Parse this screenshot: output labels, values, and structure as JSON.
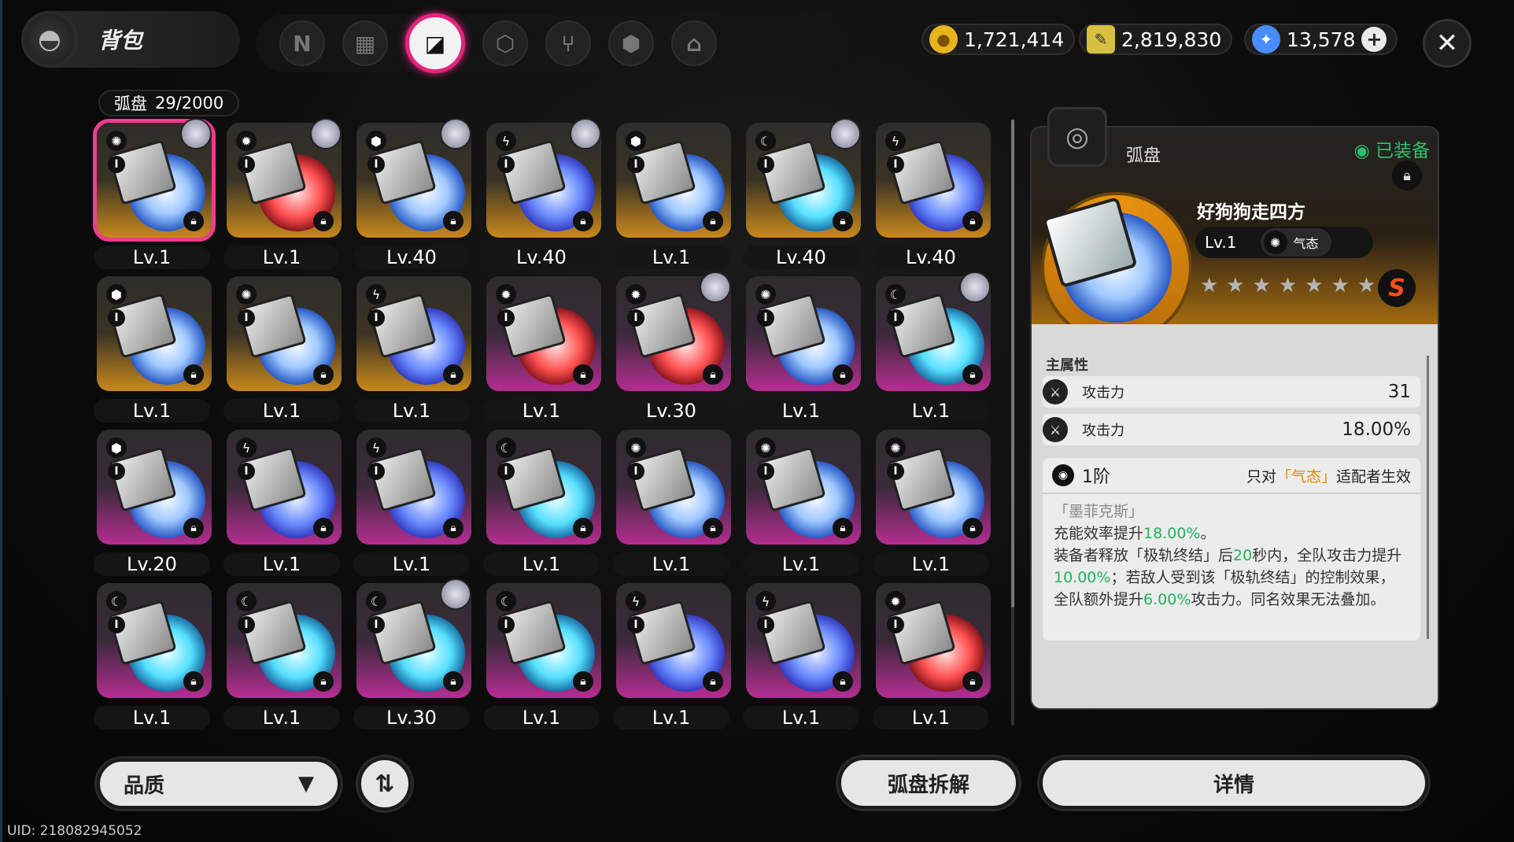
{
  "header": {
    "title": "背包",
    "nav_tabs": [
      {
        "icon": "n-logo-icon",
        "glyph": "N",
        "active": false
      },
      {
        "icon": "gameboy-icon",
        "glyph": "▦",
        "active": false
      },
      {
        "icon": "disc-drive-icon",
        "glyph": "◪",
        "active": true
      },
      {
        "icon": "cube-icon",
        "glyph": "⬡",
        "active": false
      },
      {
        "icon": "utensils-icon",
        "glyph": "⑂",
        "active": false
      },
      {
        "icon": "package-icon",
        "glyph": "⬢",
        "active": false
      },
      {
        "icon": "home-icon",
        "glyph": "⌂",
        "active": false
      }
    ],
    "currencies": [
      {
        "icon": "gold-coin-icon",
        "value": "1,721,414",
        "color": "#e8b51e"
      },
      {
        "icon": "ticket-icon",
        "value": "2,819,830",
        "color": "#d8c040"
      },
      {
        "icon": "polychrome-icon",
        "value": "13,578",
        "color": "#4a8cff"
      }
    ]
  },
  "inventory": {
    "label": "弧盘",
    "count": "29/2000",
    "items": [
      {
        "level": "Lv.1",
        "rarity": "gold",
        "disc": "white",
        "type": "✺",
        "avatar": true,
        "selected": true
      },
      {
        "level": "Lv.1",
        "rarity": "gold",
        "disc": "red",
        "type": "✹",
        "avatar": true
      },
      {
        "level": "Lv.40",
        "rarity": "gold",
        "disc": "white",
        "type": "⬢",
        "avatar": true
      },
      {
        "level": "Lv.40",
        "rarity": "gold",
        "disc": "blue",
        "type": "ϟ",
        "avatar": true
      },
      {
        "level": "Lv.1",
        "rarity": "gold",
        "disc": "white",
        "type": "⬢",
        "avatar": false
      },
      {
        "level": "Lv.40",
        "rarity": "gold",
        "disc": "cyan",
        "type": "☾",
        "avatar": true
      },
      {
        "level": "Lv.40",
        "rarity": "gold",
        "disc": "blue",
        "type": "ϟ",
        "avatar": false
      },
      {
        "level": "Lv.1",
        "rarity": "gold",
        "disc": "white",
        "type": "⬢",
        "avatar": false
      },
      {
        "level": "Lv.1",
        "rarity": "gold",
        "disc": "white",
        "type": "✺",
        "avatar": false
      },
      {
        "level": "Lv.1",
        "rarity": "gold",
        "disc": "blue",
        "type": "ϟ",
        "avatar": false
      },
      {
        "level": "Lv.1",
        "rarity": "purple",
        "disc": "red",
        "type": "✹",
        "avatar": false
      },
      {
        "level": "Lv.30",
        "rarity": "purple",
        "disc": "red",
        "type": "✹",
        "avatar": true
      },
      {
        "level": "Lv.1",
        "rarity": "purple",
        "disc": "white",
        "type": "✺",
        "avatar": false
      },
      {
        "level": "Lv.1",
        "rarity": "purple",
        "disc": "cyan",
        "type": "☾",
        "avatar": true
      },
      {
        "level": "Lv.20",
        "rarity": "purple",
        "disc": "white",
        "type": "⬢",
        "avatar": false
      },
      {
        "level": "Lv.1",
        "rarity": "purple",
        "disc": "blue",
        "type": "ϟ",
        "avatar": false
      },
      {
        "level": "Lv.1",
        "rarity": "purple",
        "disc": "blue",
        "type": "ϟ",
        "avatar": false
      },
      {
        "level": "Lv.1",
        "rarity": "purple",
        "disc": "cyan",
        "type": "☾",
        "avatar": false
      },
      {
        "level": "Lv.1",
        "rarity": "purple",
        "disc": "white",
        "type": "✺",
        "avatar": false
      },
      {
        "level": "Lv.1",
        "rarity": "purple",
        "disc": "white",
        "type": "✺",
        "avatar": false
      },
      {
        "level": "Lv.1",
        "rarity": "purple",
        "disc": "white",
        "type": "✺",
        "avatar": false
      },
      {
        "level": "Lv.1",
        "rarity": "purple",
        "disc": "cyan",
        "type": "☾",
        "avatar": false
      },
      {
        "level": "Lv.1",
        "rarity": "purple",
        "disc": "cyan",
        "type": "☾",
        "avatar": false
      },
      {
        "level": "Lv.30",
        "rarity": "purple",
        "disc": "cyan",
        "type": "☾",
        "avatar": true
      },
      {
        "level": "Lv.1",
        "rarity": "purple",
        "disc": "cyan",
        "type": "☾",
        "avatar": false
      },
      {
        "level": "Lv.1",
        "rarity": "purple",
        "disc": "blue",
        "type": "ϟ",
        "avatar": false
      },
      {
        "level": "Lv.1",
        "rarity": "purple",
        "disc": "blue",
        "type": "ϟ",
        "avatar": false
      },
      {
        "level": "Lv.1",
        "rarity": "purple",
        "disc": "red",
        "type": "✹",
        "avatar": false
      }
    ]
  },
  "detail": {
    "panel_title": "弧盘",
    "equipped": "◉ 已装备",
    "name": "好狗狗走四方",
    "level": "Lv.1",
    "attribute": "气态",
    "stars": "★★★★★★★",
    "rarity_badge": "S",
    "main_stat_label": "主属性",
    "stats": [
      {
        "name": "攻击力",
        "value": "31"
      },
      {
        "name": "攻击力",
        "value": "18.00%"
      }
    ],
    "effect": {
      "tier": "1阶",
      "limit_prefix": "只对",
      "limit_attr": "「气态」",
      "limit_suffix": "适配者生效",
      "subtitle": "「墨菲克斯」",
      "line1_a": "充能效率提升",
      "line1_b": "18.00%",
      "line1_c": "。",
      "line2_a": "装备者释放「极轨终结」后",
      "line2_b": "20",
      "line2_c": "秒内，全队攻击力提升",
      "line2_d": "10.00%",
      "line2_e": "；若敌人受到该「极轨终结」的控制效果，全队额外提升",
      "line2_f": "6.00%",
      "line2_g": "攻击力。同名效果无法叠加。"
    }
  },
  "footer": {
    "quality_label": "品质",
    "salvage_label": "弧盘拆解",
    "detail_label": "详情",
    "uid": "UID: 218082945052"
  }
}
